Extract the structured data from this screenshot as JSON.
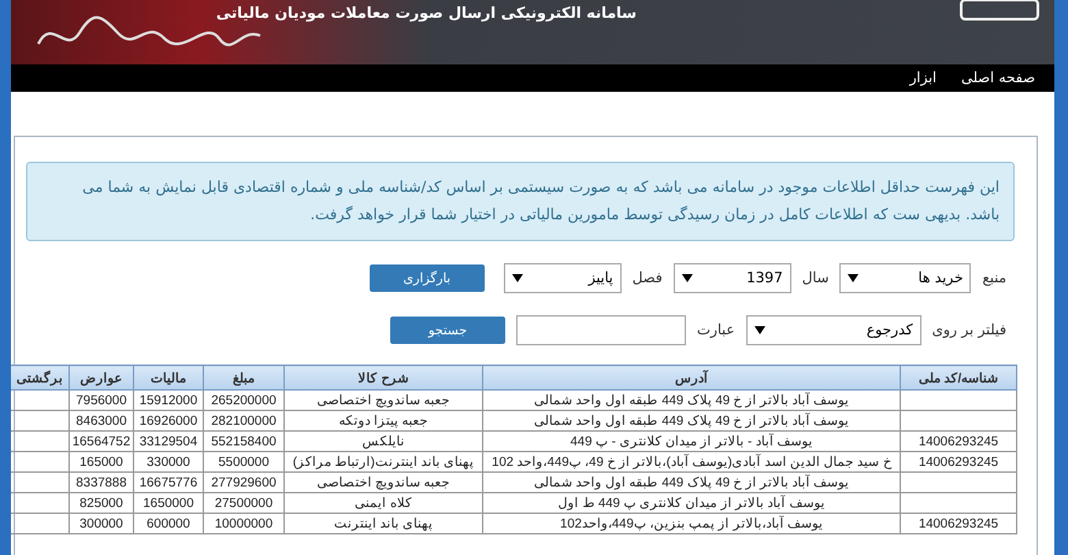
{
  "header": {
    "subtitle": "سامانه الکترونیکی ارسال صورت معاملات مودیان مالیاتی"
  },
  "nav": [
    {
      "label": "صفحه اصلی"
    },
    {
      "label": "ابزار"
    }
  ],
  "notice": "این فهرست حداقل اطلاعات موجود در سامانه می باشد که به صورت سیستمی بر اساس کد/شناسه ملی و شماره اقتصادی قابل نمایش به شما می باشد. بدیهی ست که اطلاعات کامل در زمان رسیدگی توسط مامورین مالیاتی در اختیار شما قرار خواهد گرفت.",
  "form_row_1": {
    "fields": [
      {
        "label": "منبع",
        "value": "خرید ها"
      },
      {
        "label": "سال",
        "value": "1397"
      },
      {
        "label": "فصل",
        "value": "پاییز"
      }
    ],
    "button": "بارگزاری"
  },
  "form_row_2": {
    "filter_label": "فیلتر بر روی",
    "filter_value": "کدرجوع",
    "term_label": "عبارت",
    "button": "جستجو"
  },
  "table": {
    "columns": [
      "شناسه/کد ملی",
      "آدرس",
      "شرح کالا",
      "مبلغ",
      "مالیات",
      "عوارض",
      "برگشتی"
    ],
    "rows": [
      [
        "",
        "یوسف آباد بالاتر از خ 49 پلاک 449 طبقه اول واحد شمالی",
        "جعبه ساندویچ اختصاصی",
        "265200000",
        "15912000",
        "7956000",
        ""
      ],
      [
        "",
        "یوسف آباد بالاتر از خ 49 پلاک 449 طبقه اول واحد شمالی",
        "جعبه پیتزا دوتکه",
        "282100000",
        "16926000",
        "8463000",
        ""
      ],
      [
        "14006293245",
        "یوسف آباد - بالاتر از میدان کلانتری - پ 449",
        "نایلکس",
        "552158400",
        "33129504",
        "16564752",
        ""
      ],
      [
        "14006293245",
        "خ سید جمال الدین اسد آبادی(یوسف آباد)،بالاتر از خ 49، پ449،واحد 102",
        "پهنای باند اینترنت(ارتباط مراکز)",
        "5500000",
        "330000",
        "165000",
        ""
      ],
      [
        "",
        "یوسف آباد بالاتر از خ 49 پلاک 449 طبقه اول واحد شمالی",
        "جعبه ساندویچ اختصاصی",
        "277929600",
        "16675776",
        "8337888",
        ""
      ],
      [
        "",
        "یوسف آباد بالاتر از میدان کلانتری پ 449 ط اول",
        "کلاه ایمنی",
        "27500000",
        "1650000",
        "825000",
        ""
      ],
      [
        "14006293245",
        "یوسف آباد،بالاتر از پمپ بنزین، پ449،واحد102",
        "پهنای باند اینترنت",
        "10000000",
        "600000",
        "300000",
        ""
      ]
    ]
  }
}
